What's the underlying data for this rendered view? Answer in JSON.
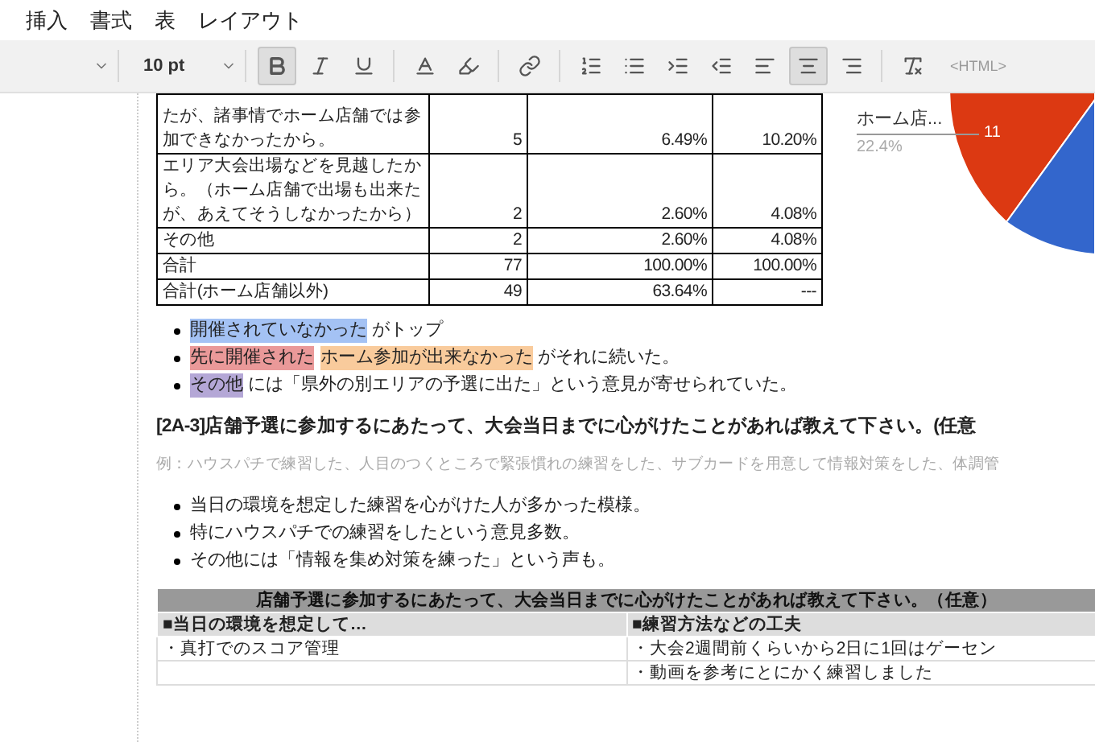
{
  "menu": [
    "挿入",
    "書式",
    "表",
    "レイアウト"
  ],
  "toolbar": {
    "font_size": "10 pt",
    "html_label": "<HTML>",
    "buttons": [
      {
        "kind": "bold",
        "selected": true
      },
      {
        "kind": "italic",
        "selected": false
      },
      {
        "kind": "underline",
        "selected": false
      },
      {
        "kind": "text-color",
        "selected": false
      },
      {
        "kind": "highlight",
        "selected": false
      },
      {
        "kind": "link",
        "selected": false
      },
      {
        "kind": "numbered-list",
        "selected": false
      },
      {
        "kind": "bullet-list",
        "selected": false
      },
      {
        "kind": "indent",
        "selected": false
      },
      {
        "kind": "outdent",
        "selected": false
      },
      {
        "kind": "align-left",
        "selected": false
      },
      {
        "kind": "align-center",
        "selected": true
      },
      {
        "kind": "align-right",
        "selected": false
      },
      {
        "kind": "clear-format",
        "selected": false
      }
    ]
  },
  "table": {
    "rows": [
      {
        "label": "たが、諸事情でホーム店舗では参加できなかったから。",
        "count": "5",
        "share": "6.49%",
        "share_excl": "10.20%"
      },
      {
        "label": "エリア大会出場などを見越したから。（ホーム店舗で出場も出来たが、あえてそうしなかったから）",
        "count": "2",
        "share": "2.60%",
        "share_excl": "4.08%"
      },
      {
        "label": "その他",
        "count": "2",
        "share": "2.60%",
        "share_excl": "4.08%"
      },
      {
        "label": "合計",
        "count": "77",
        "share": "100.00%",
        "share_excl": "100.00%"
      },
      {
        "label": "合計(ホーム店舗以外)",
        "count": "49",
        "share": "63.64%",
        "share_excl": "---"
      }
    ]
  },
  "pie": {
    "label": "ホーム店...",
    "percent": "22.4%",
    "slice_value": "11"
  },
  "summary": [
    {
      "parts": [
        {
          "text": "開催されていなかった",
          "color": "#a4c2f4"
        },
        {
          "text": " がトップ"
        }
      ]
    },
    {
      "parts": [
        {
          "text": "先に開催された",
          "color": "#ea9999"
        },
        {
          "text": "ホーム参加が出来なかった",
          "color": "#f9cb9c"
        },
        {
          "text": " がそれに続いた。"
        }
      ]
    },
    {
      "parts": [
        {
          "text": "その他",
          "color": "#b4a7d6"
        },
        {
          "text": " には「県外の別エリアの予選に出た」という意見が寄せられていた。"
        }
      ]
    }
  ],
  "heading": "[2A-3]店舗予選に参加するにあたって、大会当日までに心がけたことがあれば教えて下さい。(任意",
  "example": "例：ハウスパチで練習した、人目のつくところで緊張慣れの練習をした、サブカードを用意して情報対策をした、体調管",
  "findings": [
    "当日の環境を想定した練習を心がけた人が多かった模様。",
    "特にハウスパチでの練習をしたという意見多数。",
    "その他には「情報を集め対策を練った」という声も。"
  ],
  "answers": {
    "title": "店舗予選に参加するにあたって、大会当日までに心がけたことがあれば教えて下さい。（任意）",
    "columns": [
      "■当日の環境を想定して…",
      "■練習方法などの工夫"
    ],
    "rows": [
      [
        "・真打でのスコア管理",
        "・大会2週間前くらいから2日に1回はゲーセン"
      ],
      [
        "",
        "・動画を参考にとにかく練習しました"
      ]
    ]
  }
}
